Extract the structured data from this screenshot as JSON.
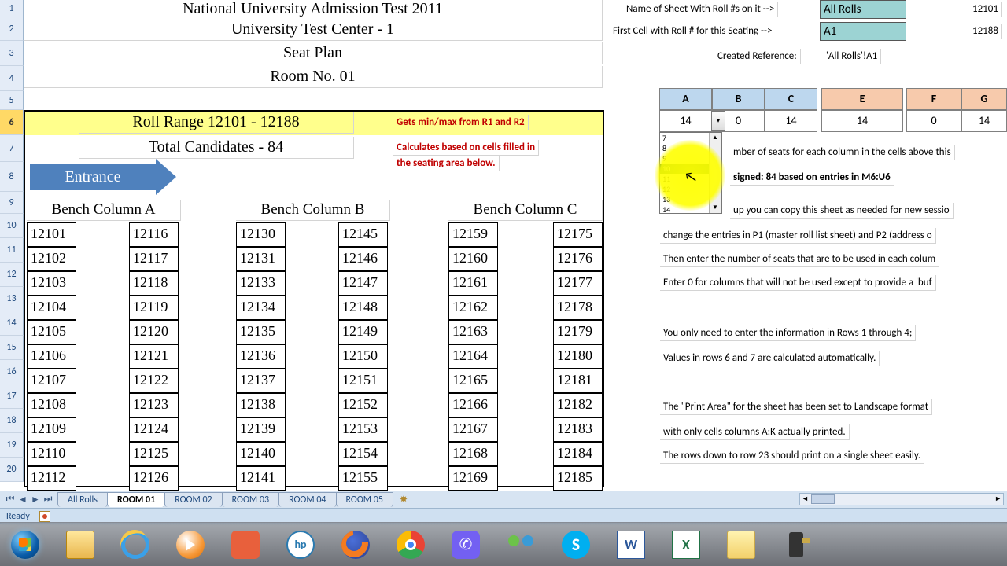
{
  "header": {
    "line1": "National University Admission Test 2011",
    "line2": "University Test Center - 1",
    "line3": "Seat Plan",
    "line4": "Room No. 01"
  },
  "row_numbers": [
    1,
    2,
    3,
    4,
    5,
    6,
    7,
    8,
    9,
    10,
    11,
    12,
    13,
    14,
    15,
    16,
    17,
    18,
    19,
    20
  ],
  "selected_row": 6,
  "summary": {
    "roll_range": "Roll Range 12101 - 12188",
    "total_candidates": "Total Candidates - 84",
    "note_minmax": "Gets min/max from R1 and R2",
    "note_calc1": "Calculates based on cells filled in",
    "note_calc2": "the seating area below."
  },
  "entrance_label": "Entrance",
  "benches": {
    "headers": [
      "Bench Column A",
      "Bench Column B",
      "Bench Column C"
    ],
    "A": {
      "left": [
        12101,
        12102,
        12103,
        12104,
        12105,
        12106,
        12107,
        12108,
        12109,
        12110,
        12112
      ],
      "right": [
        12116,
        12117,
        12118,
        12119,
        12120,
        12121,
        12122,
        12123,
        12124,
        12125,
        12126
      ]
    },
    "B": {
      "left": [
        12130,
        12131,
        12133,
        12134,
        12135,
        12136,
        12137,
        12138,
        12139,
        12140,
        12141
      ],
      "right": [
        12145,
        12146,
        12147,
        12148,
        12149,
        12150,
        12151,
        12152,
        12153,
        12154,
        12155
      ]
    },
    "C": {
      "left": [
        12159,
        12160,
        12161,
        12162,
        12163,
        12164,
        12165,
        12166,
        12167,
        12168,
        12169
      ],
      "right": [
        12175,
        12176,
        12177,
        12178,
        12179,
        12180,
        12181,
        12182,
        12183,
        12184,
        12185
      ]
    }
  },
  "right_panel": {
    "label_sheet": "Name of Sheet With Roll #s on it -->",
    "val_sheet": "All Rolls",
    "num1": "12101",
    "label_firstcell": "First Cell with Roll # for this Seating -->",
    "val_firstcell": "A1",
    "num2": "12188",
    "label_created": "Created Reference:",
    "val_created": "'All Rolls'!A1",
    "col_headers": [
      "A",
      "B",
      "C",
      "E",
      "F",
      "G"
    ],
    "col_values": [
      "14",
      "0",
      "14",
      "14",
      "0",
      "14"
    ],
    "dropdown_items": [
      "7",
      "8",
      "9",
      "10",
      "11",
      "12",
      "13",
      "14"
    ],
    "dropdown_selected": "10",
    "line_seats": "mber of seats for each column in the cells above this",
    "line_assigned": "signed: 84 based on entries in M6:U6",
    "line_copy": "up you can copy this sheet as needed for new sessio",
    "line_change": "change the entries in P1 (master roll list sheet) and P2 (address o",
    "line_then": "Then enter the number of seats that are to be used in each colum",
    "line_zero": "Enter 0 for columns that will not be used except to provide a 'buf",
    "line_rows14": "You only need to enter the information in Rows 1 through 4;",
    "line_vals67": "Values in rows 6 and 7 are calculated automatically.",
    "line_print": "The \"Print Area\" for the sheet has been set to Landscape format",
    "line_cols": "with only cells columns A:K actually printed.",
    "line_rows23": "The rows down to row 23 should print on a single sheet easily."
  },
  "tabs": {
    "items": [
      "All Rolls",
      "ROOM 01",
      "ROOM 02",
      "ROOM 03",
      "ROOM 04",
      "ROOM 05"
    ],
    "active": "ROOM 01"
  },
  "status": {
    "ready": "Ready"
  },
  "taskbar": {
    "items": [
      "start-orb",
      "file-explorer",
      "ie",
      "media-player",
      "reader",
      "hp",
      "firefox",
      "chrome",
      "viber",
      "people",
      "skype",
      "word",
      "excel",
      "notes",
      "device"
    ]
  }
}
